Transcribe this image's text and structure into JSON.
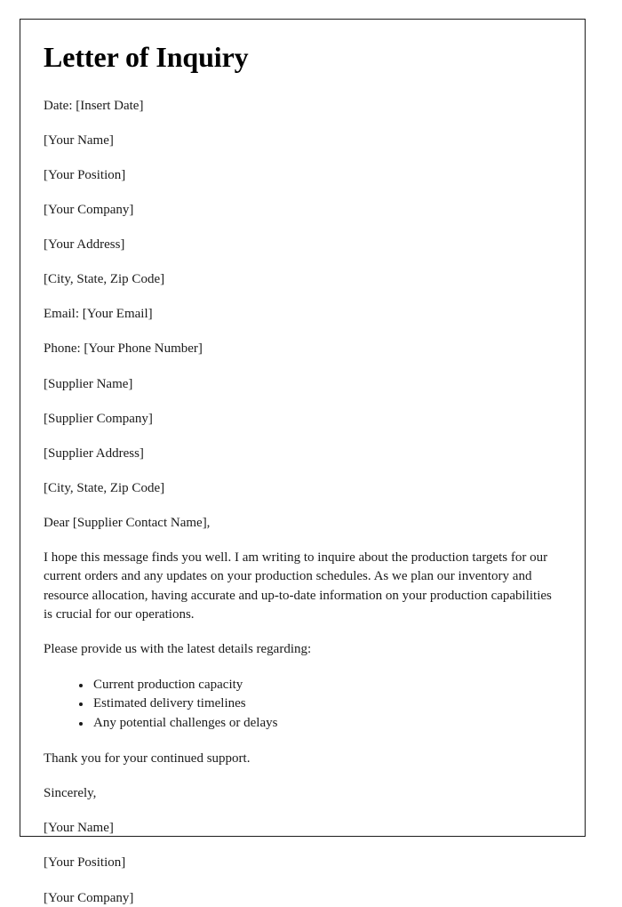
{
  "document": {
    "title": "Letter of Inquiry",
    "date_line": "Date: [Insert Date]",
    "sender": {
      "name": "[Your Name]",
      "position": "[Your Position]",
      "company": "[Your Company]",
      "address": "[Your Address]",
      "city_state_zip": "[City, State, Zip Code]",
      "email": "Email: [Your Email]",
      "phone": "Phone: [Your Phone Number]"
    },
    "recipient": {
      "name": "[Supplier Name]",
      "company": "[Supplier Company]",
      "address": "[Supplier Address]",
      "city_state_zip": "[City, State, Zip Code]"
    },
    "salutation": "Dear [Supplier Contact Name],",
    "body_paragraph": "I hope this message finds you well. I am writing to inquire about the production targets for our current orders and any updates on your production schedules. As we plan our inventory and resource allocation, having accurate and up-to-date information on your production capabilities is crucial for our operations.",
    "request_intro": "Please provide us with the latest details regarding:",
    "request_items": [
      "Current production capacity",
      "Estimated delivery timelines",
      "Any potential challenges or delays"
    ],
    "thanks": "Thank you for your continued support.",
    "closing": "Sincerely,",
    "signature": {
      "name": "[Your Name]",
      "position": "[Your Position]",
      "company": "[Your Company]"
    }
  }
}
